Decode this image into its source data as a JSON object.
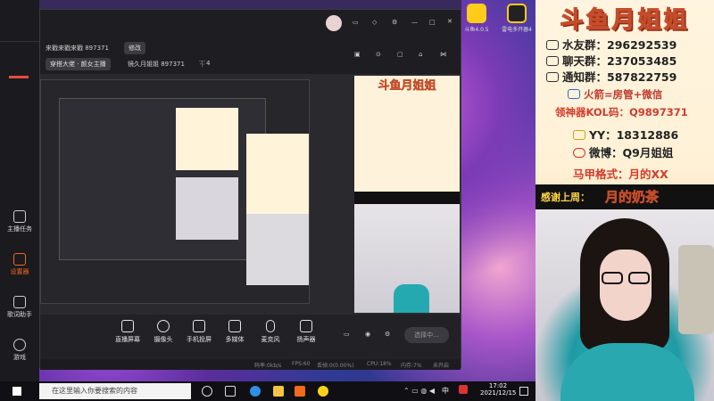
{
  "main_window": {
    "room_title": "来戳来戳来戳 897371",
    "edit_label": "修改",
    "category_tag": "穿搭大佬 · 颜女主播",
    "room_id_text": "镜久月姐姐 897371",
    "fans_count": "4"
  },
  "left_panel": {
    "items": [
      {
        "label": "主播任务"
      },
      {
        "label": "设置器"
      },
      {
        "label": "歌词助手"
      },
      {
        "label": "游戏"
      }
    ]
  },
  "toolbar": {
    "buttons": [
      {
        "label": "直播屏幕"
      },
      {
        "label": "摄像头"
      },
      {
        "label": "手机投屏"
      },
      {
        "label": "多媒体"
      },
      {
        "label": "麦克风"
      },
      {
        "label": "扬声器"
      }
    ],
    "start_label": "选择中..."
  },
  "statusbar": {
    "items": [
      "码率:0kb/s",
      "FPS:60",
      "丢帧:0(0.00%)",
      "CPU:18%",
      "内存:7%",
      "未开启"
    ]
  },
  "overlay": {
    "title": "斗鱼月姐姐",
    "lines": [
      {
        "label": "水友群：",
        "value": "296292539"
      },
      {
        "label": "聊天群：",
        "value": "237053485"
      },
      {
        "label": "通知群：",
        "value": "587822759"
      }
    ],
    "rocket_line": "火箭=房管+微信",
    "kol_line": "领神器KOL码：Q9897371",
    "yy_line": "YY：18312886",
    "weibo_line": "微博：Q9月姐姐",
    "armor_line": "马甲格式：月的XX",
    "thanks_label": "感谢上周：",
    "thanks_value": "月的奶茶"
  },
  "desktop": {
    "icon_labels": [
      "斗鱼4.0.5",
      "雷电多开器4"
    ]
  },
  "taskbar": {
    "search_placeholder": "在这里输入你要搜索的内容",
    "time": "17:02",
    "date": "2021/12/15",
    "ime": "中"
  },
  "colors": {
    "accent_orange": "#f26a1b",
    "overlay_title": "#ffd447",
    "thanks_text": "#ffd447"
  }
}
